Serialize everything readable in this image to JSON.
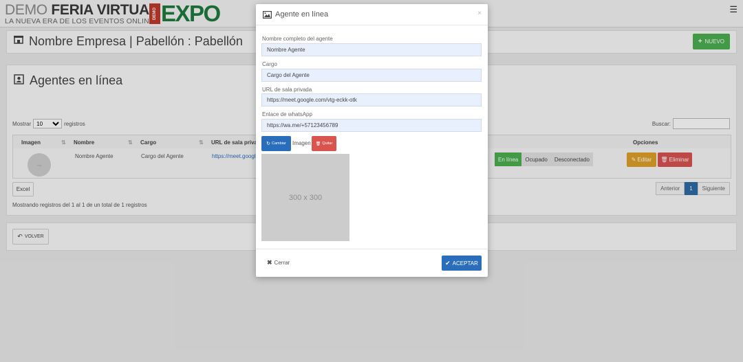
{
  "header": {
    "brand_demo": "DEMO",
    "brand_main": "FERIA VIRTUAL",
    "tagline": "LA NUEVA ERA DE LOS EVENTOS ONLINE",
    "expo_badge": "DEMO",
    "expo_word": "EXPO",
    "menu_icon": "hamburger-icon"
  },
  "company_panel": {
    "title": "Nombre Empresa | Pabellón : Pabellón",
    "new_button": "NUEVO"
  },
  "agents_panel": {
    "title": "Agentes en línea",
    "show_label": "Mostrar",
    "show_value": "10",
    "records_label": "registros",
    "search_label": "Buscar:",
    "columns": [
      "Imagen",
      "Nombre",
      "Cargo",
      "URL de sala privada",
      "Opciones"
    ],
    "rows": [
      {
        "name": "Nombre Agente",
        "role": "Cargo del Agente",
        "url": "https://meet.google.c",
        "status_options": [
          "En línea",
          "Ocupado",
          "Desconectado"
        ],
        "status_selected": "En línea",
        "edit_label": "Editar",
        "delete_label": "Eliminar"
      }
    ],
    "excel_button": "Excel",
    "pager": {
      "prev": "Anterior",
      "current": "1",
      "next": "Siguiente"
    },
    "info": "Mostrando registros del 1 al 1 de un total de 1 registros"
  },
  "back_button": "VOLVER",
  "modal": {
    "title": "Agente en línea",
    "close_symbol": "×",
    "fields": [
      {
        "label": "Nombre completo del agente",
        "value": "Nombre Agente"
      },
      {
        "label": "Cargo",
        "value": "Cargo del Agente"
      },
      {
        "label": "URL de sala privada",
        "value": "https://meet.google.com/vtg-eckk-otk"
      },
      {
        "label": "Enlace de whatsApp",
        "value": "https://wa.me/+57123456789"
      }
    ],
    "change_button": "Cambiar",
    "image_label": "Imagen",
    "remove_button": "Quitar",
    "placeholder_text": "300 x 300",
    "close_button": "Cerrar",
    "accept_button": "ACEPTAR"
  },
  "colors": {
    "primary": "#2a6ebb",
    "success": "#4caf50",
    "warning": "#e0a12a",
    "danger": "#d9534f",
    "input_bg": "#e8f0fe"
  }
}
